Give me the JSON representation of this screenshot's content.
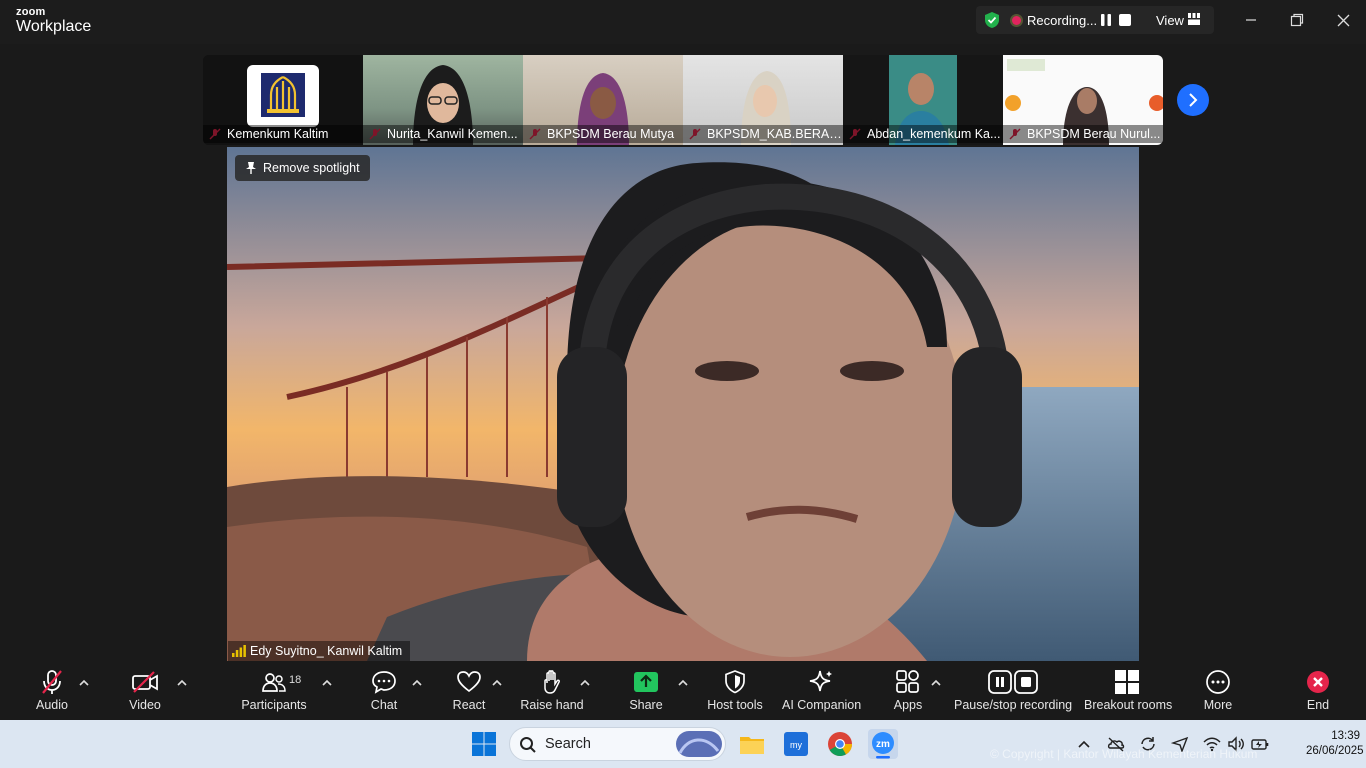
{
  "app": {
    "logo_top": "zoom",
    "logo_bottom": "Workplace",
    "recording_label": "Recording...",
    "view_label": "View"
  },
  "participants_strip": [
    {
      "name": "Kemenkum Kaltim"
    },
    {
      "name": "Nurita_Kanwil Kemen..."
    },
    {
      "name": "BKPSDM Berau Mutya"
    },
    {
      "name": "BKPSDM_KAB.BERAU_..."
    },
    {
      "name": "Abdan_kemenkum Ka..."
    },
    {
      "name": "BKPSDM Berau Nurul..."
    }
  ],
  "main_video": {
    "spotlight_label": "Remove spotlight",
    "speaker_name": "Edy Suyitno_ Kanwil Kaltim"
  },
  "toolbar": {
    "audio": "Audio",
    "video": "Video",
    "participants": "Participants",
    "participants_count": "18",
    "chat": "Chat",
    "react": "React",
    "raise_hand": "Raise hand",
    "share": "Share",
    "host_tools": "Host tools",
    "ai_companion": "AI Companion",
    "apps": "Apps",
    "pause_stop": "Pause/stop recording",
    "breakout": "Breakout rooms",
    "more": "More",
    "end": "End"
  },
  "taskbar": {
    "search_label": "Search",
    "time": "13:39",
    "date": "26/06/2025",
    "watermark": "© Copyright | Kantor Wilayah Kementerian Hukum"
  },
  "colors": {
    "accent": "#1f6fff",
    "share_green": "#22c55e",
    "recording_red": "#e0245e",
    "end_red": "#e5254b"
  }
}
